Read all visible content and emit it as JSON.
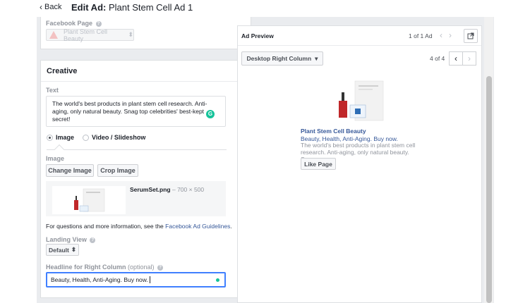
{
  "header": {
    "back_label": "Back",
    "title_prefix": "Edit Ad:",
    "title_name": "Plant Stem Cell Ad 1"
  },
  "facebook_page": {
    "label": "Facebook Page",
    "selected": "Plant Stem Cell Beauty"
  },
  "creative": {
    "heading": "Creative",
    "text_label": "Text",
    "text_value": "The world's best products in plant stem cell research. Anti-aging, only natural beauty. Snag top celebrities' best-kept secret!",
    "format_options": [
      "Image",
      "Video / Slideshow"
    ],
    "selected_format": "Image",
    "image_label": "Image",
    "change_image_label": "Change Image",
    "crop_image_label": "Crop Image",
    "file_name": "SerumSet.png",
    "file_dims": " – 700 × 500",
    "guidelines_prefix": "For questions and more information, see the",
    "guidelines_link": "Facebook Ad Guidelines",
    "guidelines_suffix": ".",
    "landing_view_label": "Landing View",
    "landing_view_value": "Default",
    "headline_label": "Headline for Right Column",
    "headline_optional": "(optional)",
    "headline_value": "Beauty, Health, Anti-Aging. Buy now."
  },
  "preview": {
    "title": "Ad Preview",
    "pager": "1 of 1 Ad",
    "placement": "Desktop Right Column",
    "placement_count": "4 of 4",
    "ad_title": "Plant Stem Cell Beauty",
    "ad_headline": "Beauty, Health, Anti-Aging. Buy now.",
    "ad_body": "The world's best products in plant stem cell research. Anti-aging, only natural beauty. Sn...",
    "like_label": "Like Page"
  },
  "colors": {
    "link": "#365899",
    "focus": "#4080ff",
    "grammarly": "#15c39a"
  },
  "icons": [
    "chevron-left-icon",
    "help-icon",
    "warning-icon",
    "grammarly-icon",
    "external-link-icon",
    "caret-down-icon"
  ]
}
